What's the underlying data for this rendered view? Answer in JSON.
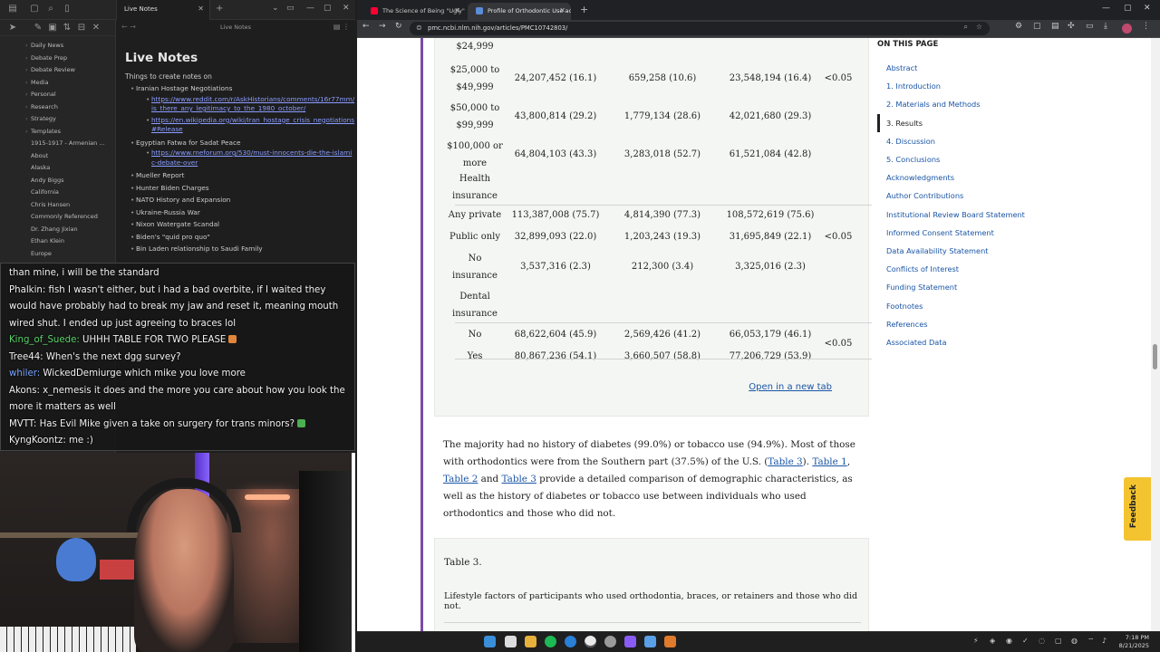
{
  "obsidian": {
    "tab_title": "Live Notes",
    "breadcrumb": "Live Notes",
    "note_title": "Live Notes",
    "note_subtitle": "Things to create notes on",
    "sidebar_folders": [
      "Daily News",
      "Debate Prep",
      "Debate Review",
      "Media",
      "Personal",
      "Research",
      "Strategy",
      "Templates"
    ],
    "sidebar_files": [
      "1915-1917 - Armenian ...",
      "About",
      "Alaska",
      "Andy Biggs",
      "California",
      "Chris Hansen",
      "Commonly Referenced",
      "Dr. Zhang Jixian",
      "Ethan Klein",
      "Europe"
    ],
    "bullets": [
      {
        "text": "Iranian Hostage Negotiations",
        "links": [
          "https://www.reddit.com/r/AskHistorians/comments/16r77mm/is_there_any_legitimacy_to_the_1980_october/",
          "https://en.wikipedia.org/wiki/Iran_hostage_crisis_negotiations#Release"
        ]
      },
      {
        "text": "Egyptian Fatwa for Sadat Peace",
        "links": [
          "https://www.meforum.org/530/must-innocents-die-the-islamic-debate-over"
        ]
      },
      {
        "text": "Mueller Report",
        "links": []
      },
      {
        "text": "Hunter Biden Charges",
        "links": []
      },
      {
        "text": "NATO History and Expansion",
        "links": []
      },
      {
        "text": "Ukraine-Russia War",
        "links": []
      },
      {
        "text": "Nixon Watergate Scandal",
        "links": []
      },
      {
        "text": "Biden's \"quid pro quo\"",
        "links": []
      },
      {
        "text": "Bin Laden relationship to Saudi Family",
        "links": []
      }
    ]
  },
  "chat": [
    {
      "user": "",
      "msg": "than mine, i will be the standard",
      "user_color": ""
    },
    {
      "user": "Phalkin:",
      "msg": " fish I wasn't either, but i had a bad overbite, if I waited they would have probably had to break my jaw and reset it, meaning mouth wired shut. I ended up just agreeing to braces lol",
      "user_color": ""
    },
    {
      "user": "King_of_Suede:",
      "msg": " UHHH TABLE FOR TWO PLEASE",
      "user_color": "#58d36a"
    },
    {
      "user": "Tree44:",
      "msg": " When's the next dgg survey?",
      "user_color": ""
    },
    {
      "user": "whiler:",
      "msg": " WickedDemiurge which mike you love more",
      "user_color": "#7aa6ff"
    },
    {
      "user": "Akons:",
      "msg": " x_nemesis it does and the more you care about how you look the more it matters as well",
      "user_color": ""
    },
    {
      "user": "MVTT:",
      "msg": " Has Evil Mike given a take on surgery for trans minors?",
      "user_color": ""
    },
    {
      "user": "KyngKoontz:",
      "msg": " me :)",
      "user_color": ""
    }
  ],
  "browser": {
    "tabs": [
      {
        "title": "The Science of Being \"Ugly\" | D",
        "favicon_color": "#ff0033",
        "active": false
      },
      {
        "title": "Profile of Orthodontic Use acro",
        "favicon_color": "#5b8dd9",
        "active": true
      }
    ],
    "url": "pmc.ncbi.nlm.nih.gov/articles/PMC10742803/"
  },
  "table": {
    "rows": [
      {
        "label": "$24,999",
        "c1": "",
        "c2": "",
        "c3": "",
        "p": ""
      },
      {
        "label": "$25,000 to\n$49,999",
        "c1": "24,207,452 (16.1)",
        "c2": "659,258 (10.6)",
        "c3": "23,548,194 (16.4)",
        "p": "<0.05"
      },
      {
        "label": "$50,000 to\n$99,999",
        "c1": "43,800,814 (29.2)",
        "c2": "1,779,134 (28.6)",
        "c3": "42,021,680 (29.3)",
        "p": ""
      },
      {
        "label": "$100,000 or\nmore",
        "c1": "64,804,103 (43.3)",
        "c2": "3,283,018 (52.7)",
        "c3": "61,521,084 (42.8)",
        "p": ""
      },
      {
        "label": "Health\ninsurance",
        "c1": "",
        "c2": "",
        "c3": "",
        "p": ""
      },
      {
        "label": "Any private",
        "c1": "113,387,008 (75.7)",
        "c2": "4,814,390 (77.3)",
        "c3": "108,572,619 (75.6)",
        "p": ""
      },
      {
        "label": "Public only",
        "c1": "32,899,093 (22.0)",
        "c2": "1,203,243 (19.3)",
        "c3": "31,695,849 (22.1)",
        "p": "<0.05"
      },
      {
        "label": "No\ninsurance",
        "c1": "3,537,316 (2.3)",
        "c2": "212,300 (3.4)",
        "c3": "3,325,016 (2.3)",
        "p": ""
      },
      {
        "label": "Dental\ninsurance",
        "c1": "",
        "c2": "",
        "c3": "",
        "p": ""
      },
      {
        "label": "No",
        "c1": "68,622,604 (45.9)",
        "c2": "2,569,426 (41.2)",
        "c3": "66,053,179 (46.1)",
        "p": ""
      },
      {
        "label": "Yes",
        "c1": "80,867,236 (54.1)",
        "c2": "3,660,507 (58.8)",
        "c3": "77,206,729 (53.9)",
        "p": ""
      }
    ],
    "dental_p": "<0.05",
    "open_new_tab": "Open in a new tab"
  },
  "paragraph": {
    "p1": "The majority had no history of diabetes (99.0%) or tobacco use (94.9%). Most of those with orthodontics were from the Southern part (37.5%) of the U.S. (",
    "l1": "Table 3",
    "p2": "). ",
    "l2": "Table 1",
    "p3": ", ",
    "l3": "Table 2",
    "p4": " and ",
    "l4": "Table 3",
    "p5": " provide a detailed comparison of demographic characteristics, as well as the history of diabetes or tobacco use between individuals who used orthodontics and those who did not."
  },
  "table3": {
    "title": "Table 3.",
    "caption": "Lifestyle factors of participants who used orthodontia, braces, or retainers and those who did not."
  },
  "toc": {
    "heading": "ON THIS PAGE",
    "items": [
      "Abstract",
      "1. Introduction",
      "2. Materials and Methods",
      "3. Results",
      "4. Discussion",
      "5. Conclusions",
      "Acknowledgments",
      "Author Contributions",
      "Institutional Review Board Statement",
      "Informed Consent Statement",
      "Data Availability Statement",
      "Conflicts of Interest",
      "Funding Statement",
      "Footnotes",
      "References",
      "Associated Data"
    ],
    "current": "3. Results"
  },
  "feedback_label": "Feedback",
  "clock": {
    "time": "7:18 PM",
    "date": "8/21/2025"
  }
}
